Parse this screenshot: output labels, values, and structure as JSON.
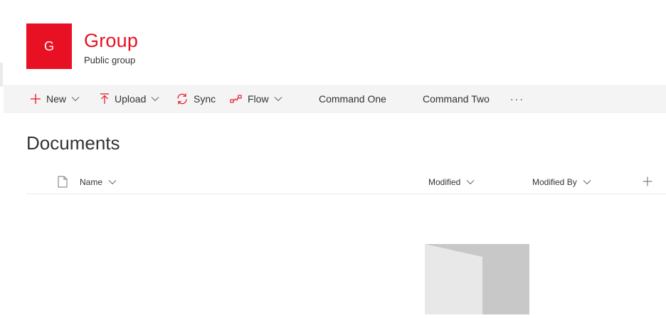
{
  "header": {
    "logo_initial": "G",
    "title": "Group",
    "subtitle": "Public group"
  },
  "command_bar": {
    "new_label": "New",
    "upload_label": "Upload",
    "sync_label": "Sync",
    "flow_label": "Flow",
    "command_one_label": "Command One",
    "command_two_label": "Command Two",
    "more_label": "···"
  },
  "library": {
    "title": "Documents",
    "columns": {
      "name": "Name",
      "modified": "Modified",
      "modified_by": "Modified By"
    }
  },
  "colors": {
    "accent": "#e81123",
    "command_bar_bg": "#f4f4f4",
    "text": "#333333"
  }
}
